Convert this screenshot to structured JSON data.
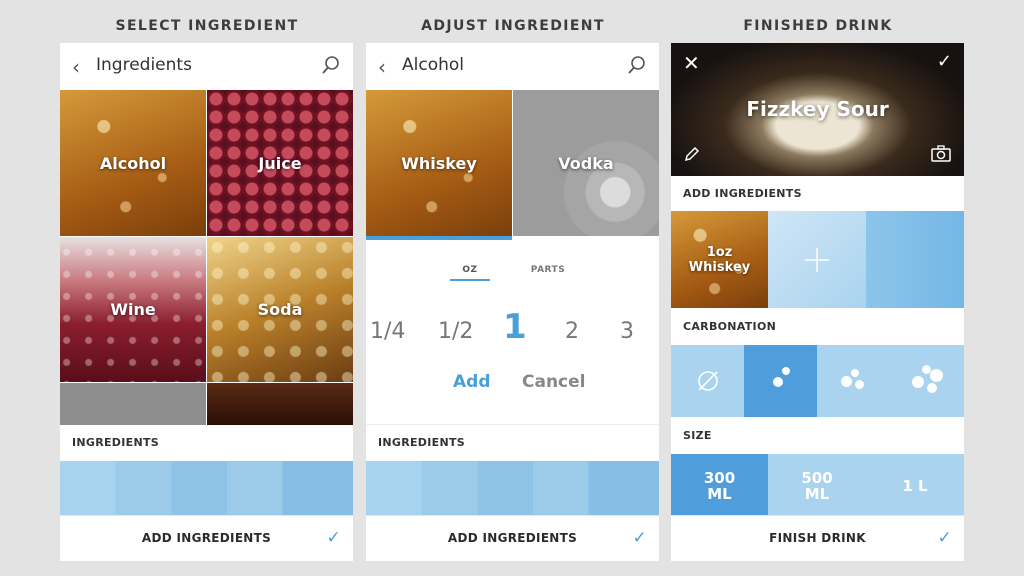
{
  "screens": {
    "select": {
      "label": "SELECT INGREDIENT",
      "header_title": "Ingredients",
      "tiles": [
        "Alcohol",
        "Juice",
        "Wine",
        "Soda"
      ],
      "section_label": "INGREDIENTS",
      "bottom_label": "ADD INGREDIENTS"
    },
    "adjust": {
      "label": "ADJUST INGREDIENT",
      "header_title": "Alcohol",
      "tiles": [
        "Whiskey",
        "Vodka"
      ],
      "unit_tabs": [
        "OZ",
        "PARTS"
      ],
      "amounts": [
        "1/4",
        "1/2",
        "1",
        "2",
        "3"
      ],
      "selected_amount": "1",
      "add_label": "Add",
      "cancel_label": "Cancel",
      "section_label": "INGREDIENTS",
      "bottom_label": "ADD INGREDIENTS"
    },
    "finished": {
      "label": "FINISHED DRINK",
      "drink_name": "Fizzkey Sour",
      "add_ingredients_label": "ADD INGREDIENTS",
      "ingredient_amount": "1oz",
      "ingredient_name": "Whiskey",
      "carbonation_label": "CARBONATION",
      "size_label": "SIZE",
      "sizes": [
        {
          "num": "300",
          "unit": "ML"
        },
        {
          "num": "500",
          "unit": "ML"
        },
        {
          "num": "1 L",
          "unit": ""
        }
      ],
      "bottom_label": "FINISH DRINK"
    }
  },
  "colors": {
    "accent": "#4a9fd8",
    "background": "#e3e3e3"
  },
  "icons": [
    "back-icon",
    "search-icon",
    "close-icon",
    "check-icon",
    "pencil-icon",
    "camera-icon",
    "plus-icon",
    "no-bubbles-icon"
  ]
}
